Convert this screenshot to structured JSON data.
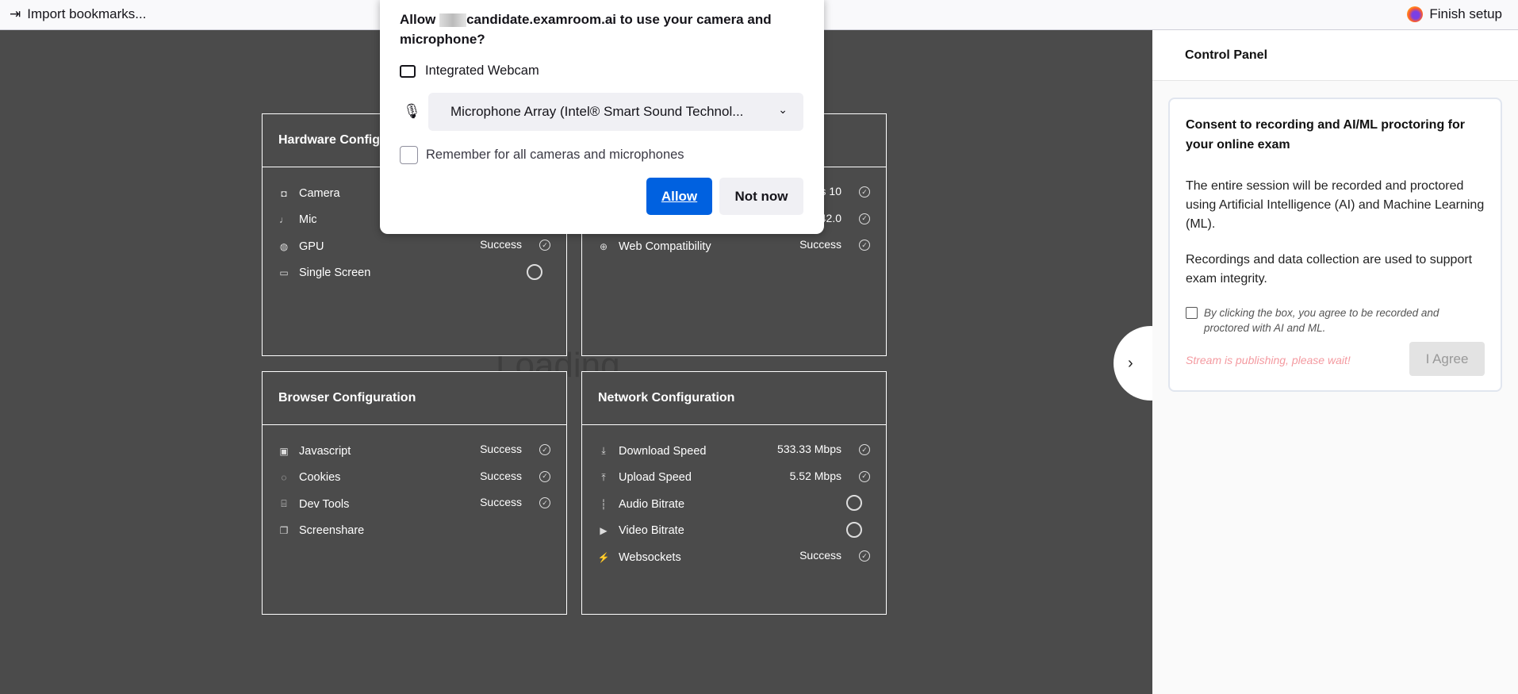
{
  "browser": {
    "import_bookmarks": "Import bookmarks...",
    "finish_setup": "Finish setup"
  },
  "loading": "Loading",
  "permission_dialog": {
    "title_prefix": "Allow ",
    "title_suffix": "candidate.examroom.ai to use your camera and microphone?",
    "camera": "Integrated Webcam",
    "microphone": "Microphone Array (Intel® Smart Sound Technol...",
    "remember": "Remember for all cameras and microphones",
    "allow": "Allow",
    "not_now": "Not now"
  },
  "hardware": {
    "title": "Hardware Configuration",
    "items": [
      {
        "label": "Camera",
        "icon": "camera-icon"
      },
      {
        "label": "Mic",
        "icon": "mic-icon"
      },
      {
        "label": "GPU",
        "icon": "gauge-icon",
        "status": "Success"
      },
      {
        "label": "Single Screen",
        "icon": "monitor-icon",
        "pending": true
      }
    ]
  },
  "system": {
    "items": [
      {
        "value": "ws 10"
      },
      {
        "value": "42.0"
      },
      {
        "label": "Web Compatibility",
        "icon": "globe-icon",
        "status": "Success"
      }
    ]
  },
  "browser_config": {
    "title": "Browser Configuration",
    "items": [
      {
        "label": "Javascript",
        "status": "Success"
      },
      {
        "label": "Cookies",
        "status": "Success"
      },
      {
        "label": "Dev Tools",
        "status": "Success"
      },
      {
        "label": "Screenshare"
      }
    ]
  },
  "network": {
    "title": "Network Configuration",
    "items": [
      {
        "label": "Download Speed",
        "status": "533.33 Mbps"
      },
      {
        "label": "Upload Speed",
        "status": "5.52 Mbps"
      },
      {
        "label": "Audio Bitrate",
        "pending": true
      },
      {
        "label": "Video Bitrate",
        "pending": true
      },
      {
        "label": "Websockets",
        "status": "Success"
      }
    ]
  },
  "control_panel": {
    "title": "Control Panel",
    "consent_title": "Consent to recording and AI/ML proctoring for your online exam",
    "p1": "The entire session will be recorded and proctored using Artificial Intelligence (AI) and Machine Learning (ML).",
    "p2": "Recordings and data collection are used to support exam integrity.",
    "checkbox_label": "By clicking the box, you agree to be recorded and proctored with AI and ML.",
    "wait_message": "Stream is publishing, please wait!",
    "agree": "I Agree"
  },
  "colors": {
    "accent": "#0061e0",
    "background": "#4b4b4b",
    "warning": "#f49aa0"
  }
}
